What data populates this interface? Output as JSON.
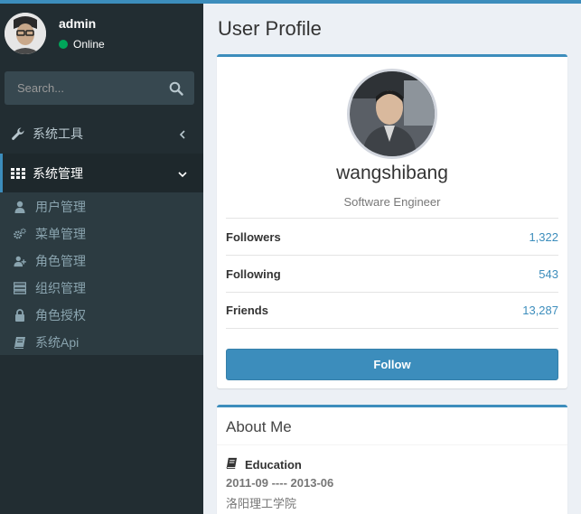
{
  "user": {
    "name": "admin",
    "status": "Online"
  },
  "search": {
    "placeholder": "Search..."
  },
  "sidebar": {
    "menus": [
      {
        "label": "系统工具",
        "icon": "wrench-icon"
      },
      {
        "label": "系统管理",
        "icon": "grid-icon"
      }
    ],
    "submenu": [
      {
        "label": "用户管理",
        "icon": "user-icon"
      },
      {
        "label": "菜单管理",
        "icon": "cogs-icon"
      },
      {
        "label": "角色管理",
        "icon": "user-plus-icon"
      },
      {
        "label": "组织管理",
        "icon": "server-icon"
      },
      {
        "label": "角色授权",
        "icon": "lock-icon"
      },
      {
        "label": "系统Api",
        "icon": "book-icon"
      }
    ]
  },
  "page": {
    "title": "User Profile"
  },
  "profile": {
    "username": "wangshibang",
    "job": "Software Engineer",
    "stats": [
      {
        "label": "Followers",
        "value": "1,322"
      },
      {
        "label": "Following",
        "value": "543"
      },
      {
        "label": "Friends",
        "value": "13,287"
      }
    ],
    "follow_label": "Follow"
  },
  "about": {
    "title": "About Me",
    "education_heading": "Education",
    "education_dates": "2011-09 ---- 2013-06",
    "education_school": "洛阳理工学院"
  },
  "colors": {
    "accent": "#3c8dbc",
    "sidebar": "#222d32",
    "online": "#00a65a"
  }
}
